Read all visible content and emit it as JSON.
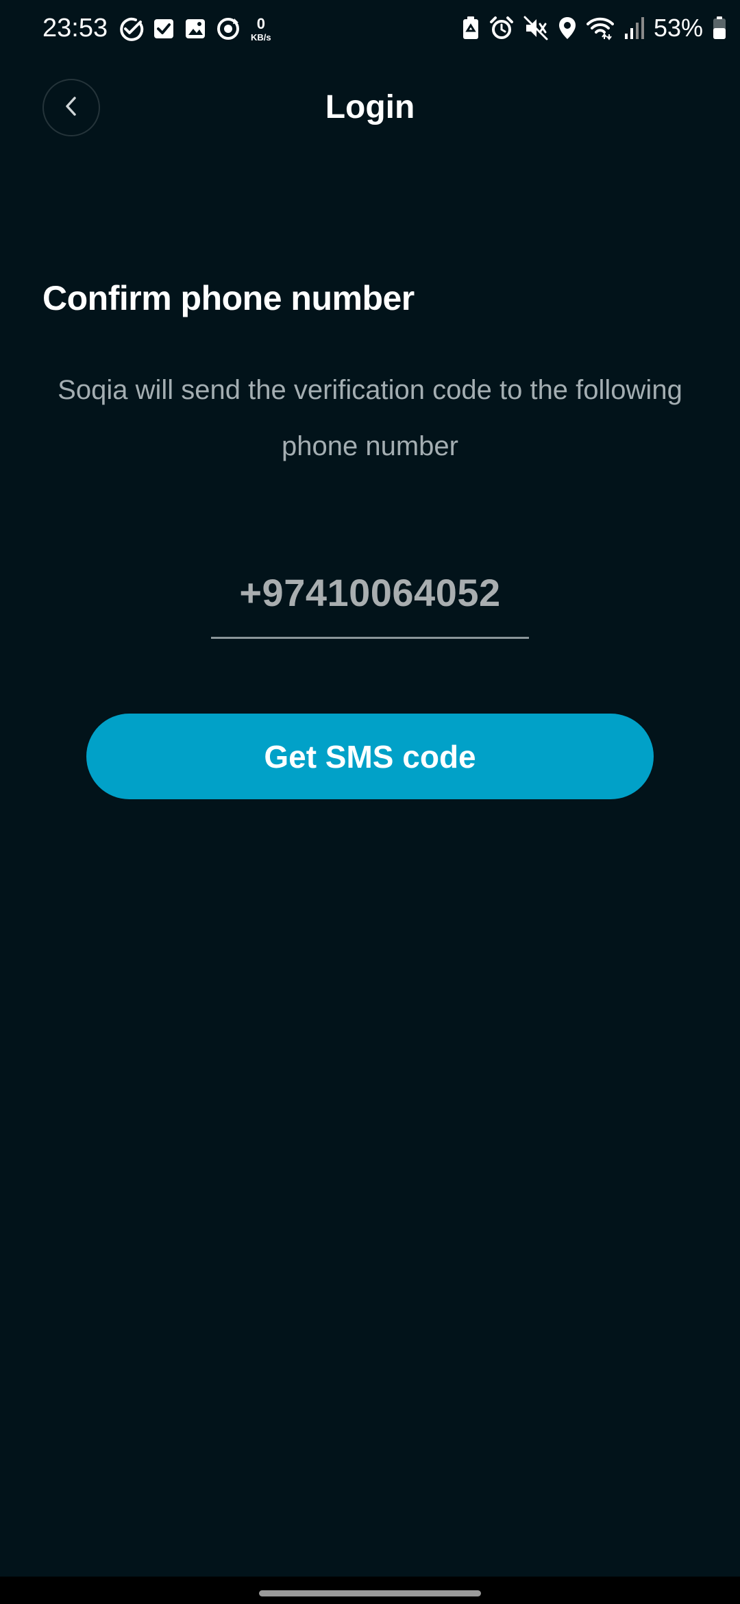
{
  "status_bar": {
    "time": "23:53",
    "net_speed_value": "0",
    "net_speed_unit": "KB/s",
    "battery_percent": "53%",
    "left_icons": [
      "check-circle-icon",
      "checkbox-icon",
      "gallery-icon",
      "sync-icon"
    ],
    "right_icons": [
      "battery-saver-icon",
      "alarm-icon",
      "mute-icon",
      "location-icon",
      "wifi-icon",
      "signal-icon",
      "battery-icon"
    ]
  },
  "header": {
    "back_icon": "chevron-left-icon",
    "title": "Login"
  },
  "content": {
    "heading": "Confirm phone number",
    "description": "Soqia will send the verification code to the following phone number",
    "phone_number": "+97410064052"
  },
  "actions": {
    "sms_button_label": "Get SMS code"
  },
  "colors": {
    "background": "#02131a",
    "accent": "#01a1c8",
    "text_primary": "#ffffff",
    "text_secondary": "#a4aeb2"
  }
}
